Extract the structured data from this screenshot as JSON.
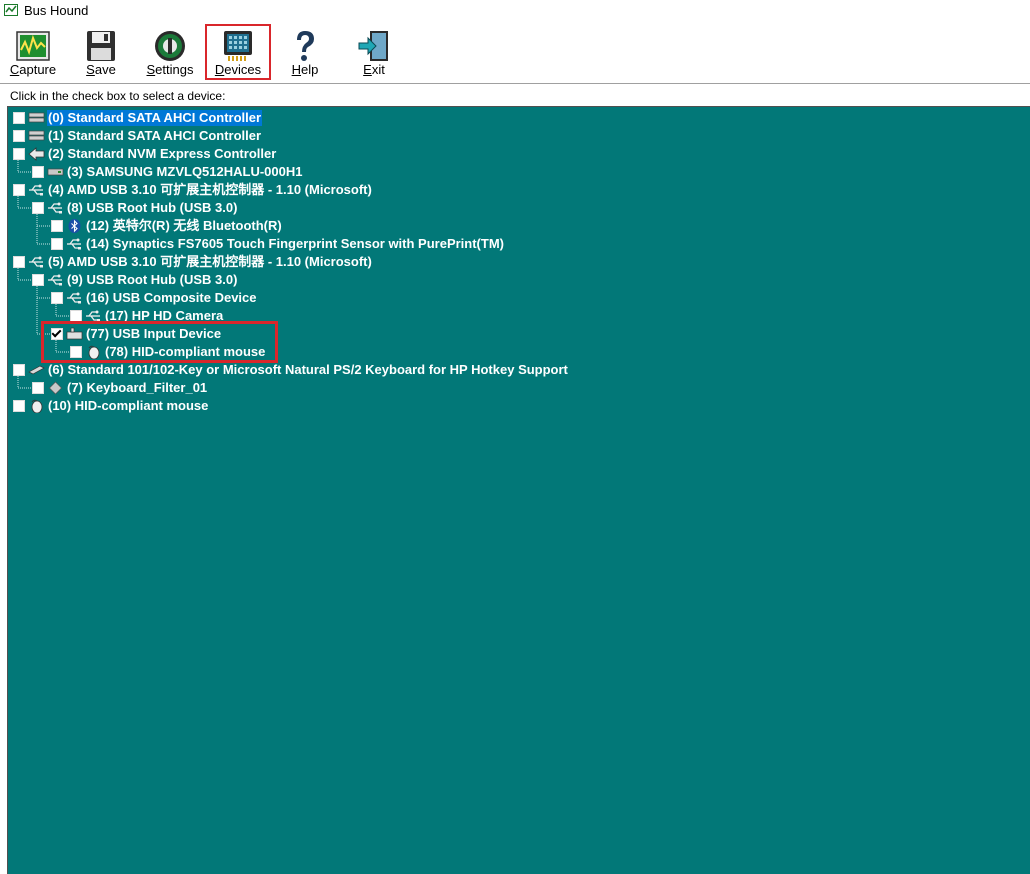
{
  "window": {
    "title": "Bus Hound"
  },
  "toolbar": {
    "buttons": [
      {
        "label": "Capture",
        "icon": "capture-icon"
      },
      {
        "label": "Save",
        "icon": "save-icon"
      },
      {
        "label": "Settings",
        "icon": "settings-icon"
      },
      {
        "label": "Devices",
        "icon": "devices-icon",
        "selected": true
      },
      {
        "label": "Help",
        "icon": "help-icon"
      },
      {
        "label": "Exit",
        "icon": "exit-icon"
      }
    ]
  },
  "hint": "Click in the check box to select a device:",
  "colors": {
    "tree_bg": "#027878",
    "selection": "#0078d7",
    "highlight": "#d9262b"
  },
  "devices": [
    {
      "label": "(0) Standard SATA AHCI Controller",
      "icon": "disk-controller-icon",
      "checked": false,
      "selected": true
    },
    {
      "label": "(1) Standard SATA AHCI Controller",
      "icon": "disk-controller-icon",
      "checked": false
    },
    {
      "label": "(2) Standard NVM Express Controller",
      "icon": "nvme-controller-icon",
      "checked": false
    },
    {
      "label": "(3)  SAMSUNG MZVLQ512HALU-000H1",
      "icon": "drive-icon",
      "checked": false
    },
    {
      "label": "(4) AMD USB 3.10 可扩展主机控制器 - 1.10 (Microsoft)",
      "icon": "usb-icon",
      "checked": false
    },
    {
      "label": "(8) USB Root Hub (USB 3.0)",
      "icon": "usb-icon",
      "checked": false
    },
    {
      "label": "(12) 英特尔(R) 无线 Bluetooth(R)",
      "icon": "bluetooth-icon",
      "checked": false
    },
    {
      "label": "(14) Synaptics FS7605 Touch Fingerprint Sensor with PurePrint(TM)",
      "icon": "usb-icon",
      "checked": false
    },
    {
      "label": "(5) AMD USB 3.10 可扩展主机控制器 - 1.10 (Microsoft)",
      "icon": "usb-icon",
      "checked": false
    },
    {
      "label": "(9) USB Root Hub (USB 3.0)",
      "icon": "usb-icon",
      "checked": false
    },
    {
      "label": "(16) USB Composite Device",
      "icon": "usb-icon",
      "checked": false
    },
    {
      "label": "(17) HP HD Camera",
      "icon": "usb-icon",
      "checked": false
    },
    {
      "label": "(77) USB Input Device",
      "icon": "hid-icon",
      "checked": true
    },
    {
      "label": "(78) HID-compliant mouse",
      "icon": "mouse-icon",
      "checked": false
    },
    {
      "label": "(6) Standard 101/102-Key or Microsoft Natural PS/2 Keyboard for HP Hotkey Support",
      "icon": "keyboard-icon",
      "checked": false
    },
    {
      "label": "(7) Keyboard_Filter_01",
      "icon": "filter-icon",
      "checked": false
    },
    {
      "label": "(10) HID-compliant mouse",
      "icon": "mouse-icon",
      "checked": false
    }
  ]
}
